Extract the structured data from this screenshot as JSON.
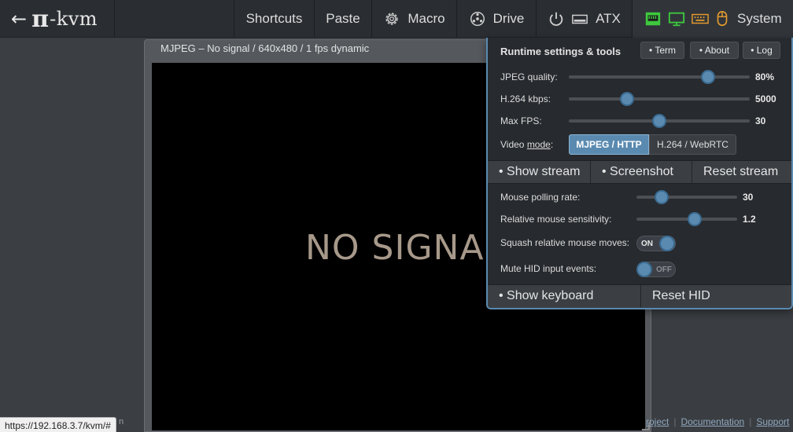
{
  "navbar": {
    "logo": {
      "arrow": "←",
      "pi": "π",
      "kvm": "-kvm"
    },
    "items": {
      "shortcuts": "Shortcuts",
      "paste": "Paste",
      "macro": "Macro",
      "drive": "Drive",
      "atx": "ATX",
      "system": "System"
    },
    "icons": [
      "gear-icon",
      "drive-icon",
      "power-icon",
      "atx-icon",
      "ethernet-icon",
      "monitor-icon",
      "keyboard-icon",
      "mouse-icon"
    ],
    "status_colors": {
      "ethernet": "#3ec93e",
      "monitor": "#3ec93e",
      "keyboard": "#e39a2e",
      "mouse": "#e39a2e"
    }
  },
  "stream": {
    "title": "MJPEG – No signal / 640x480 / 1 fps dynamic",
    "no_signal": "NO SIGNAL"
  },
  "status_bar": {
    "url": "https://192.168.3.7/kvm/#"
  },
  "footer": {
    "partial_left": "n",
    "links": [
      "roject",
      "Documentation",
      "Support"
    ]
  },
  "panel": {
    "title": "Runtime settings & tools",
    "buttons": {
      "term": "• Term",
      "about": "• About",
      "log": "• Log"
    },
    "jpeg_quality": {
      "label": "JPEG quality:",
      "value": "80%",
      "level": 0.77
    },
    "h264_kbps": {
      "label": "H.264 kbps:",
      "value": "5000",
      "level": 0.32
    },
    "max_fps": {
      "label": "Max FPS:",
      "value": "30",
      "level": 0.5
    },
    "video_mode": {
      "label_prefix": "Video ",
      "label_underlined": "mode",
      "label_suffix": ":",
      "options": [
        "MJPEG / HTTP",
        "H.264 / WebRTC"
      ],
      "selected": "MJPEG / HTTP"
    },
    "stream_actions": {
      "show_stream": "• Show stream",
      "screenshot": "• Screenshot",
      "reset_stream": "Reset stream"
    },
    "mouse_polling_rate": {
      "label": "Mouse polling rate:",
      "value": "30",
      "level": 0.25
    },
    "relative_mouse_sensitivity": {
      "label": "Relative mouse sensitivity:",
      "value": "1.2",
      "level": 0.58
    },
    "squash_relative": {
      "label": "Squash relative mouse moves:",
      "state": "ON"
    },
    "mute_hid": {
      "label": "Mute HID input events:",
      "state": "OFF"
    },
    "hid_actions": {
      "show_keyboard": "• Show keyboard",
      "reset_hid": "Reset HID"
    },
    "accent_color": "#5a8ab0"
  }
}
